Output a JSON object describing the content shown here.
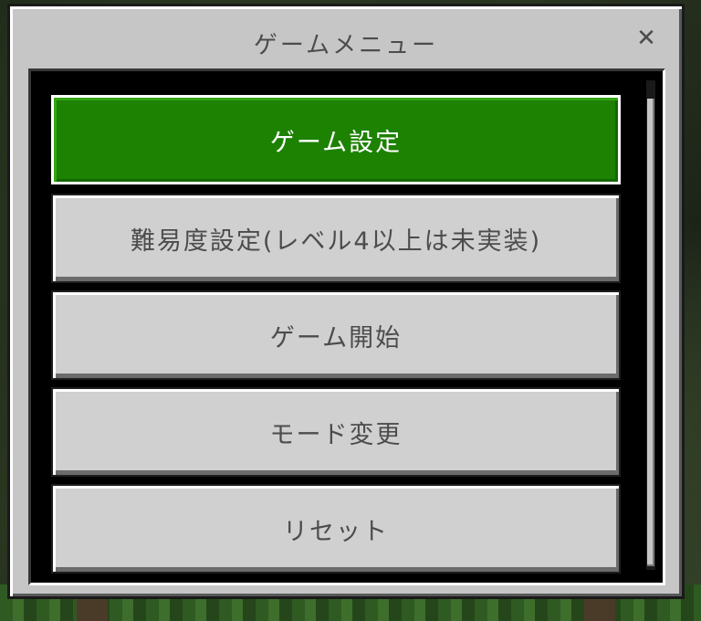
{
  "dialog": {
    "title": "ゲームメニュー",
    "close_glyph": "✕"
  },
  "menu": {
    "items": [
      {
        "label": "ゲーム設定",
        "selected": true
      },
      {
        "label": "難易度設定(レベル4以上は未実装)",
        "selected": false
      },
      {
        "label": "ゲーム開始",
        "selected": false
      },
      {
        "label": "モード変更",
        "selected": false
      },
      {
        "label": "リセット",
        "selected": false
      }
    ]
  },
  "colors": {
    "selected_button": "#1d8102",
    "button_bg": "#d0d0d0",
    "dialog_bg": "#c6c6c6",
    "text": "#4c4c4c"
  },
  "icons": {
    "close": "close-icon"
  }
}
